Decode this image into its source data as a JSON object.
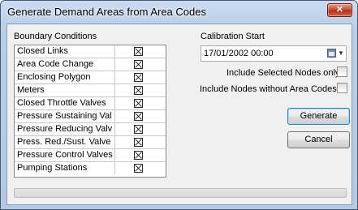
{
  "window": {
    "title": "Generate Demand Areas from Area Codes",
    "close_symbol": "✕"
  },
  "boundary": {
    "heading": "Boundary Conditions",
    "rows": [
      {
        "label": "Closed Links",
        "checked": true
      },
      {
        "label": "Area Code Change",
        "checked": true
      },
      {
        "label": "Enclosing Polygon",
        "checked": true
      },
      {
        "label": "Meters",
        "checked": true
      },
      {
        "label": "Closed Throttle Valves",
        "checked": true
      },
      {
        "label": "Pressure Sustaining Val",
        "checked": true
      },
      {
        "label": "Pressure Reducing Valv",
        "checked": true
      },
      {
        "label": "Press. Red./Sust. Valve",
        "checked": true
      },
      {
        "label": "Pressure Control Valves",
        "checked": true
      },
      {
        "label": "Pumping Stations",
        "checked": true
      }
    ]
  },
  "calibration": {
    "heading": "Calibration Start",
    "value": "17/01/2002 00:00",
    "calendar_icon": "calendar-icon"
  },
  "options": {
    "include_selected_label": "Include Selected Nodes only",
    "include_selected_checked": false,
    "include_without_label": "Include Nodes without Area Codes",
    "include_without_checked": false
  },
  "buttons": {
    "generate": "Generate",
    "cancel": "Cancel"
  },
  "progress": {
    "fraction": 0
  },
  "colors": {
    "default_button_border": "#3c7fb1",
    "close_button": "#c7452c"
  }
}
